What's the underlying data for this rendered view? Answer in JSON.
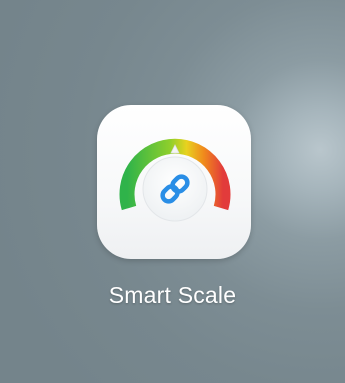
{
  "home_screen": {
    "app": {
      "label": "Smart Scale",
      "icon": "gauge-link-icon",
      "colors": {
        "gauge_green": "#35b84a",
        "gauge_yellow": "#e8d21f",
        "gauge_orange": "#f08a1c",
        "gauge_red": "#e23b3b",
        "link_blue": "#2a8ee6"
      }
    }
  }
}
